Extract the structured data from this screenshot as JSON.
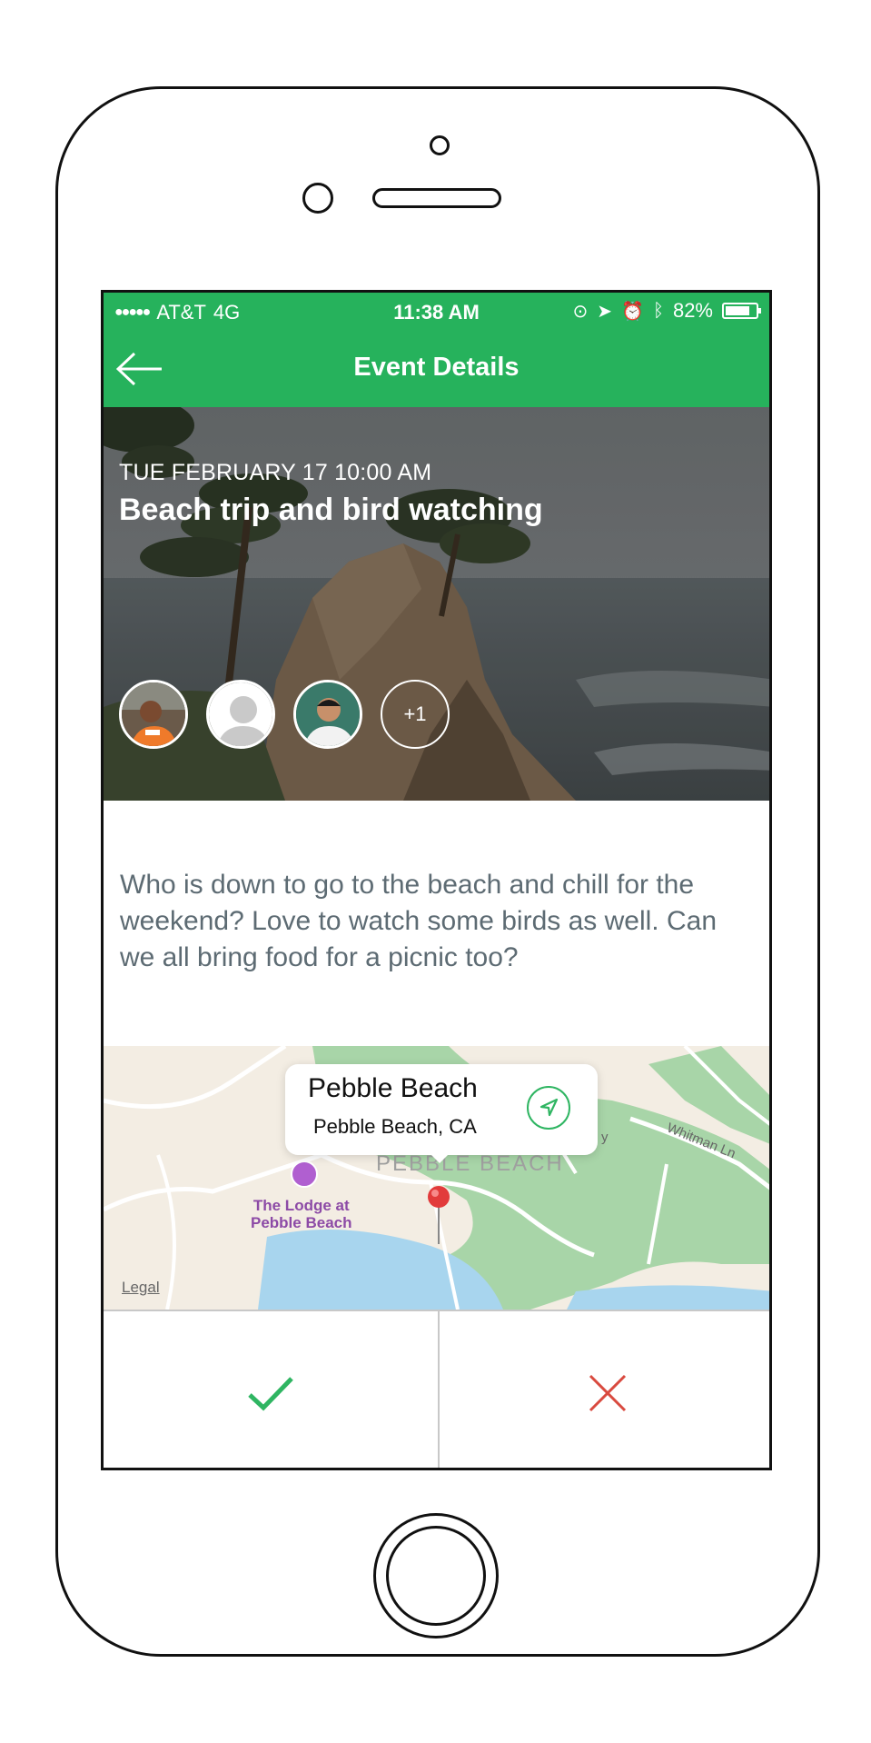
{
  "status_bar": {
    "signal": "●●●●●",
    "carrier": "AT&T",
    "network": "4G",
    "time": "11:38 AM",
    "battery_text": "82%",
    "battery_level": 0.82,
    "icons": [
      "rotation-lock-icon",
      "location-arrow-icon",
      "alarm-icon",
      "bluetooth-icon",
      "battery-icon"
    ]
  },
  "nav": {
    "title": "Event Details",
    "back_icon": "back-arrow-icon"
  },
  "event": {
    "date": "TUE FEBRUARY 17 10:00 AM",
    "title": "Beach trip and bird watching",
    "extra_attendees": "+1",
    "description": "Who is down to go to the beach and chill for the weekend? Love to watch some birds as well. Can we all bring food for a picnic too?"
  },
  "map": {
    "callout_title": "Pebble Beach",
    "callout_subtitle": "Pebble Beach, CA",
    "area_label": "PEBBLE BEACH",
    "poi_label_line1": "The Lodge at",
    "poi_label_line2": "Pebble Beach",
    "road_label_1": "Whitman Ln",
    "road_label_2": "y",
    "legal": "Legal"
  },
  "actions": {
    "accept_icon": "checkmark-icon",
    "decline_icon": "close-icon"
  },
  "colors": {
    "brand_green": "#26b25c",
    "accept_green": "#2fb562",
    "decline_red": "#d94a3f",
    "text_gray": "#5d6b73"
  }
}
